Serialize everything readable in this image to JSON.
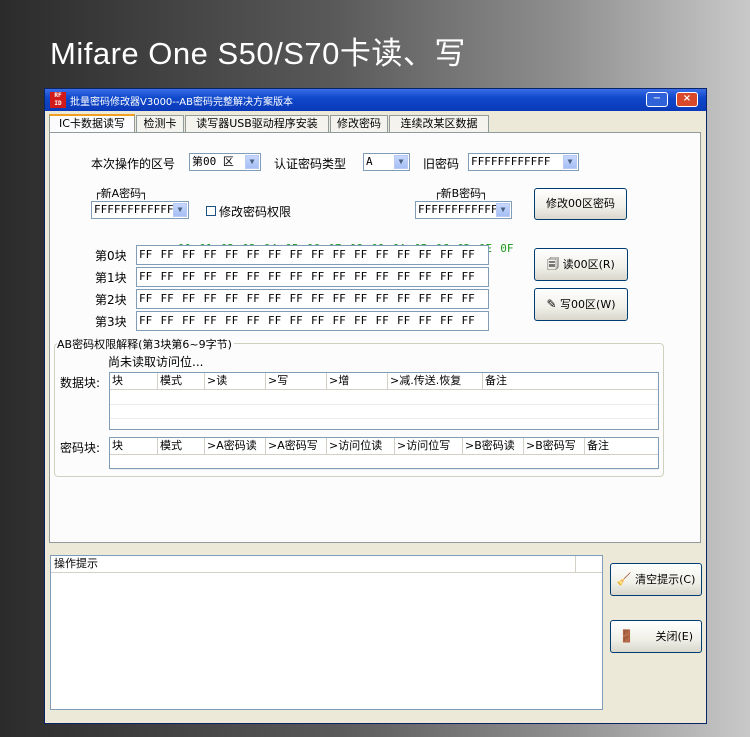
{
  "banner": "Mifare One S50/S70卡读、写",
  "window": {
    "icon": "RF ID",
    "title": "批量密码修改器V3000--AB密码完整解决方案版本",
    "min_label": "−",
    "close_label": "×"
  },
  "tabs": [
    "IC卡数据读写",
    "检测卡",
    "读写器USB驱动程序安装",
    "修改密码",
    "连续改某区数据"
  ],
  "form": {
    "sector_label": "本次操作的区号",
    "sector_value": "第00 区",
    "auth_label": "认证密码类型",
    "auth_value": "A",
    "old_key_label": "旧密码",
    "old_key_value": "FFFFFFFFFFFF",
    "new_a_label": "┌新A密码┐",
    "new_a_value": "FFFFFFFFFFFF",
    "modify_perm_label": "修改密码权限",
    "new_b_label": "┌新B密码┐",
    "new_b_value": "FFFFFFFFFFFF",
    "modify_btn": "修改00区密码"
  },
  "hex": {
    "header": [
      "00",
      "01",
      "02",
      "03",
      "04",
      "05",
      "06",
      "07",
      "08",
      "09",
      "0A",
      "0B",
      "0C",
      "0D",
      "0E",
      "0F"
    ],
    "blocks": [
      {
        "label": "第0块",
        "bytes": [
          "FF",
          "FF",
          "FF",
          "FF",
          "FF",
          "FF",
          "FF",
          "FF",
          "FF",
          "FF",
          "FF",
          "FF",
          "FF",
          "FF",
          "FF",
          "FF"
        ]
      },
      {
        "label": "第1块",
        "bytes": [
          "FF",
          "FF",
          "FF",
          "FF",
          "FF",
          "FF",
          "FF",
          "FF",
          "FF",
          "FF",
          "FF",
          "FF",
          "FF",
          "FF",
          "FF",
          "FF"
        ]
      },
      {
        "label": "第2块",
        "bytes": [
          "FF",
          "FF",
          "FF",
          "FF",
          "FF",
          "FF",
          "FF",
          "FF",
          "FF",
          "FF",
          "FF",
          "FF",
          "FF",
          "FF",
          "FF",
          "FF"
        ]
      },
      {
        "label": "第3块",
        "bytes": [
          "FF",
          "FF",
          "FF",
          "FF",
          "FF",
          "FF",
          "FF",
          "FF",
          "FF",
          "FF",
          "FF",
          "FF",
          "FF",
          "FF",
          "FF",
          "FF"
        ]
      }
    ],
    "read_btn": "读00区(R)",
    "write_btn": "写00区(W)"
  },
  "perm": {
    "group_title": "AB密码权限解释(第3块第6~9字节)",
    "status": "尚未读取访问位...",
    "data_label": "数据块:",
    "data_cols": [
      "块",
      "模式",
      ">读",
      ">写",
      ">增",
      ">减.传送.恢复",
      "备注"
    ],
    "key_label": "密码块:",
    "key_cols": [
      "块",
      "模式",
      ">A密码读",
      ">A密码写",
      ">访问位读",
      ">访问位写",
      ">B密码读",
      ">B密码写",
      "备注"
    ]
  },
  "log": {
    "header": "操作提示",
    "clear_btn": "清空提示(C)",
    "close_btn": "关闭(E)"
  }
}
